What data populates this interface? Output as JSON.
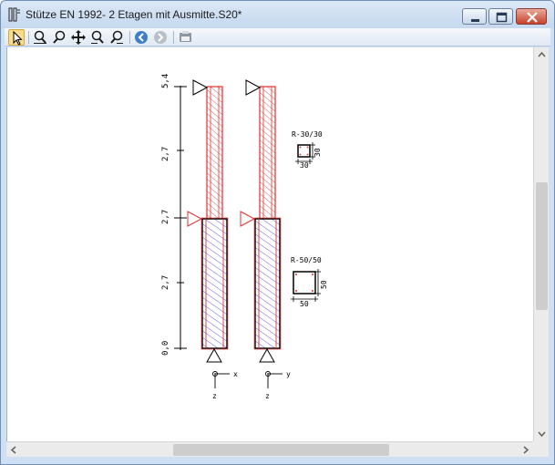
{
  "window": {
    "title": "Stütze EN 1992- 2 Etagen mit Ausmitte.S20*",
    "controls": {
      "minimize": "minimize",
      "maximize": "maximize",
      "close": "close"
    }
  },
  "toolbar": {
    "tools": [
      "select-arrow-icon",
      "zoom-extents-icon",
      "zoom-icon",
      "pan-icon",
      "zoom-in-icon",
      "zoom-out-icon",
      "back-icon",
      "forward-icon",
      "print-preview-icon"
    ]
  },
  "drawing": {
    "height_ticks": [
      "5,4",
      "2,7",
      "2,7",
      "2,7",
      "0,0"
    ],
    "section_upper": {
      "label": "R-30/30",
      "width": "30",
      "height": "30"
    },
    "section_lower": {
      "label": "R-50/50",
      "width": "50",
      "height": "50"
    },
    "axes_left": {
      "horizontal": "x",
      "vertical": "z"
    },
    "axes_right": {
      "horizontal": "y",
      "vertical": "z"
    }
  },
  "colors": {
    "title_bar": "#cfe0f4",
    "column_outline_upper": "#e03030",
    "column_hatch_lower": "#3a3ad0",
    "support_red": "#e03030"
  }
}
